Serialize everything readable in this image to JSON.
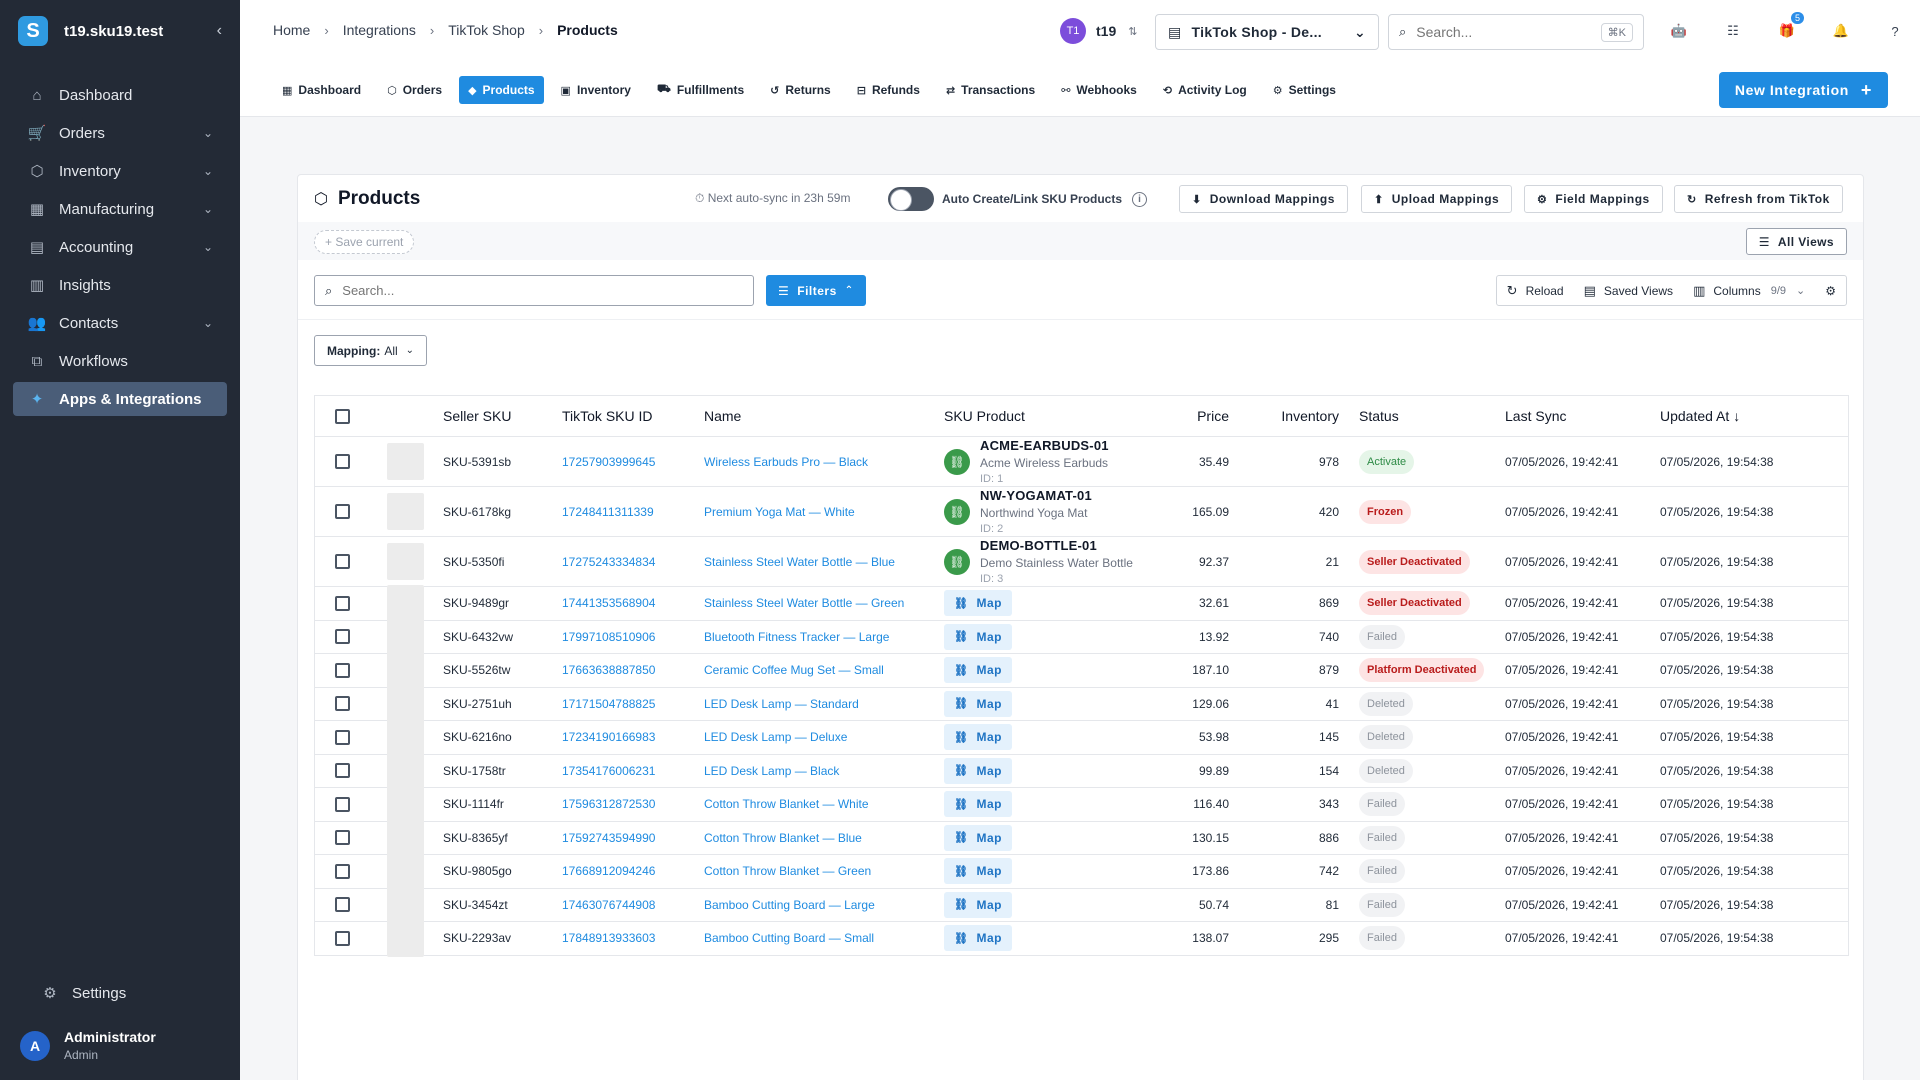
{
  "sidebar": {
    "org_name": "t19.sku19.test",
    "logo_letter": "S",
    "collapse_glyph": "‹",
    "items": [
      {
        "label": "Dashboard",
        "icon": "home-icon",
        "glyph": "⌂",
        "expandable": false,
        "active": false
      },
      {
        "label": "Orders",
        "icon": "cart-icon",
        "glyph": "🛒",
        "expandable": true,
        "active": false
      },
      {
        "label": "Inventory",
        "icon": "box-icon",
        "glyph": "⬡",
        "expandable": true,
        "active": false
      },
      {
        "label": "Manufacturing",
        "icon": "factory-icon",
        "glyph": "▦",
        "expandable": true,
        "active": false
      },
      {
        "label": "Accounting",
        "icon": "calculator-icon",
        "glyph": "▤",
        "expandable": true,
        "active": false
      },
      {
        "label": "Insights",
        "icon": "bar-chart-icon",
        "glyph": "▥",
        "expandable": false,
        "active": false
      },
      {
        "label": "Contacts",
        "icon": "users-icon",
        "glyph": "👥",
        "expandable": true,
        "active": false
      },
      {
        "label": "Workflows",
        "icon": "workflow-icon",
        "glyph": "⧉",
        "expandable": false,
        "active": false
      },
      {
        "label": "Apps & Integrations",
        "icon": "puzzle-icon",
        "glyph": "✦",
        "expandable": false,
        "active": true
      }
    ],
    "settings_label": "Settings",
    "user": {
      "initial": "A",
      "name": "Administrator",
      "role": "Admin"
    }
  },
  "header": {
    "breadcrumb": [
      "Home",
      "Integrations",
      "TikTok Shop",
      "Products"
    ],
    "tenant": {
      "badge": "T1",
      "name": "t19"
    },
    "store": "TikTok Shop - De...",
    "search_placeholder": "Search...",
    "search_shortcut": "⌘K",
    "notification_count": "5",
    "tabs": [
      {
        "label": "Dashboard",
        "glyph": "▦",
        "active": false
      },
      {
        "label": "Orders",
        "glyph": "⬡",
        "active": false
      },
      {
        "label": "Products",
        "glyph": "◆",
        "active": true
      },
      {
        "label": "Inventory",
        "glyph": "▣",
        "active": false
      },
      {
        "label": "Fulfillments",
        "glyph": "⛟",
        "active": false
      },
      {
        "label": "Returns",
        "glyph": "↺",
        "active": false
      },
      {
        "label": "Refunds",
        "glyph": "⊟",
        "active": false
      },
      {
        "label": "Transactions",
        "glyph": "⇄",
        "active": false
      },
      {
        "label": "Webhooks",
        "glyph": "⚯",
        "active": false
      },
      {
        "label": "Activity Log",
        "glyph": "⟲",
        "active": false
      },
      {
        "label": "Settings",
        "glyph": "⚙",
        "active": false
      }
    ],
    "new_integration": "New Integration"
  },
  "products": {
    "title": "Products",
    "autosync": "Next auto-sync in 23h 59m",
    "auto_create_label": "Auto Create/Link SKU Products",
    "download_mappings": "Download Mappings",
    "upload_mappings": "Upload Mappings",
    "field_mappings": "Field Mappings",
    "refresh": "Refresh from TikTok",
    "save_current": "Save current",
    "all_views": "All Views",
    "search_placeholder": "Search...",
    "filters": "Filters",
    "reload": "Reload",
    "saved_views": "Saved Views",
    "columns": "Columns",
    "columns_count": "9/9",
    "mapping_label": "Mapping:",
    "mapping_value": "All"
  },
  "table": {
    "columns": [
      "Seller SKU",
      "TikTok SKU ID",
      "Name",
      "SKU Product",
      "Price",
      "Inventory",
      "Status",
      "Last Sync",
      "Updated At"
    ],
    "map_label": "Map",
    "rows": [
      {
        "sku": "SKU-5391sb",
        "tid": "17257903999645",
        "name": "Wireless Earbuds Pro — Black",
        "linked": {
          "code": "ACME-EARBUDS-01",
          "name": "Acme Wireless Earbuds",
          "id": "ID: 1"
        },
        "price": "35.49",
        "inv": "978",
        "status": "Activate",
        "skind": "activate",
        "last": "07/05/2026, 19:42:41",
        "upd": "07/05/2026, 19:54:38"
      },
      {
        "sku": "SKU-6178kg",
        "tid": "17248411311339",
        "name": "Premium Yoga Mat — White",
        "linked": {
          "code": "NW-YOGAMAT-01",
          "name": "Northwind Yoga Mat",
          "id": "ID: 2"
        },
        "price": "165.09",
        "inv": "420",
        "status": "Frozen",
        "skind": "frozen",
        "last": "07/05/2026, 19:42:41",
        "upd": "07/05/2026, 19:54:38"
      },
      {
        "sku": "SKU-5350fi",
        "tid": "17275243334834",
        "name": "Stainless Steel Water Bottle — Blue",
        "linked": {
          "code": "DEMO-BOTTLE-01",
          "name": "Demo Stainless Water Bottle",
          "id": "ID: 3"
        },
        "price": "92.37",
        "inv": "21",
        "status": "Seller Deactivated",
        "skind": "seller",
        "last": "07/05/2026, 19:42:41",
        "upd": "07/05/2026, 19:54:38"
      },
      {
        "sku": "SKU-9489gr",
        "tid": "17441353568904",
        "name": "Stainless Steel Water Bottle — Green",
        "linked": null,
        "price": "32.61",
        "inv": "869",
        "status": "Seller Deactivated",
        "skind": "seller",
        "last": "07/05/2026, 19:42:41",
        "upd": "07/05/2026, 19:54:38"
      },
      {
        "sku": "SKU-6432vw",
        "tid": "17997108510906",
        "name": "Bluetooth Fitness Tracker — Large",
        "linked": null,
        "price": "13.92",
        "inv": "740",
        "status": "Failed",
        "skind": "failed",
        "last": "07/05/2026, 19:42:41",
        "upd": "07/05/2026, 19:54:38"
      },
      {
        "sku": "SKU-5526tw",
        "tid": "17663638887850",
        "name": "Ceramic Coffee Mug Set — Small",
        "linked": null,
        "price": "187.10",
        "inv": "879",
        "status": "Platform Deactivated",
        "skind": "platform",
        "last": "07/05/2026, 19:42:41",
        "upd": "07/05/2026, 19:54:38"
      },
      {
        "sku": "SKU-2751uh",
        "tid": "17171504788825",
        "name": "LED Desk Lamp — Standard",
        "linked": null,
        "price": "129.06",
        "inv": "41",
        "status": "Deleted",
        "skind": "deleted",
        "last": "07/05/2026, 19:42:41",
        "upd": "07/05/2026, 19:54:38"
      },
      {
        "sku": "SKU-6216no",
        "tid": "17234190166983",
        "name": "LED Desk Lamp — Deluxe",
        "linked": null,
        "price": "53.98",
        "inv": "145",
        "status": "Deleted",
        "skind": "deleted",
        "last": "07/05/2026, 19:42:41",
        "upd": "07/05/2026, 19:54:38"
      },
      {
        "sku": "SKU-1758tr",
        "tid": "17354176006231",
        "name": "LED Desk Lamp — Black",
        "linked": null,
        "price": "99.89",
        "inv": "154",
        "status": "Deleted",
        "skind": "deleted",
        "last": "07/05/2026, 19:42:41",
        "upd": "07/05/2026, 19:54:38"
      },
      {
        "sku": "SKU-1114fr",
        "tid": "17596312872530",
        "name": "Cotton Throw Blanket — White",
        "linked": null,
        "price": "116.40",
        "inv": "343",
        "status": "Failed",
        "skind": "failed",
        "last": "07/05/2026, 19:42:41",
        "upd": "07/05/2026, 19:54:38"
      },
      {
        "sku": "SKU-8365yf",
        "tid": "17592743594990",
        "name": "Cotton Throw Blanket — Blue",
        "linked": null,
        "price": "130.15",
        "inv": "886",
        "status": "Failed",
        "skind": "failed",
        "last": "07/05/2026, 19:42:41",
        "upd": "07/05/2026, 19:54:38"
      },
      {
        "sku": "SKU-9805go",
        "tid": "17668912094246",
        "name": "Cotton Throw Blanket — Green",
        "linked": null,
        "price": "173.86",
        "inv": "742",
        "status": "Failed",
        "skind": "failed",
        "last": "07/05/2026, 19:42:41",
        "upd": "07/05/2026, 19:54:38"
      },
      {
        "sku": "SKU-3454zt",
        "tid": "17463076744908",
        "name": "Bamboo Cutting Board — Large",
        "linked": null,
        "price": "50.74",
        "inv": "81",
        "status": "Failed",
        "skind": "failed",
        "last": "07/05/2026, 19:42:41",
        "upd": "07/05/2026, 19:54:38"
      },
      {
        "sku": "SKU-2293av",
        "tid": "17848913933603",
        "name": "Bamboo Cutting Board — Small",
        "linked": null,
        "price": "138.07",
        "inv": "295",
        "status": "Failed",
        "skind": "failed",
        "last": "07/05/2026, 19:42:41",
        "upd": "07/05/2026, 19:54:38"
      }
    ]
  }
}
